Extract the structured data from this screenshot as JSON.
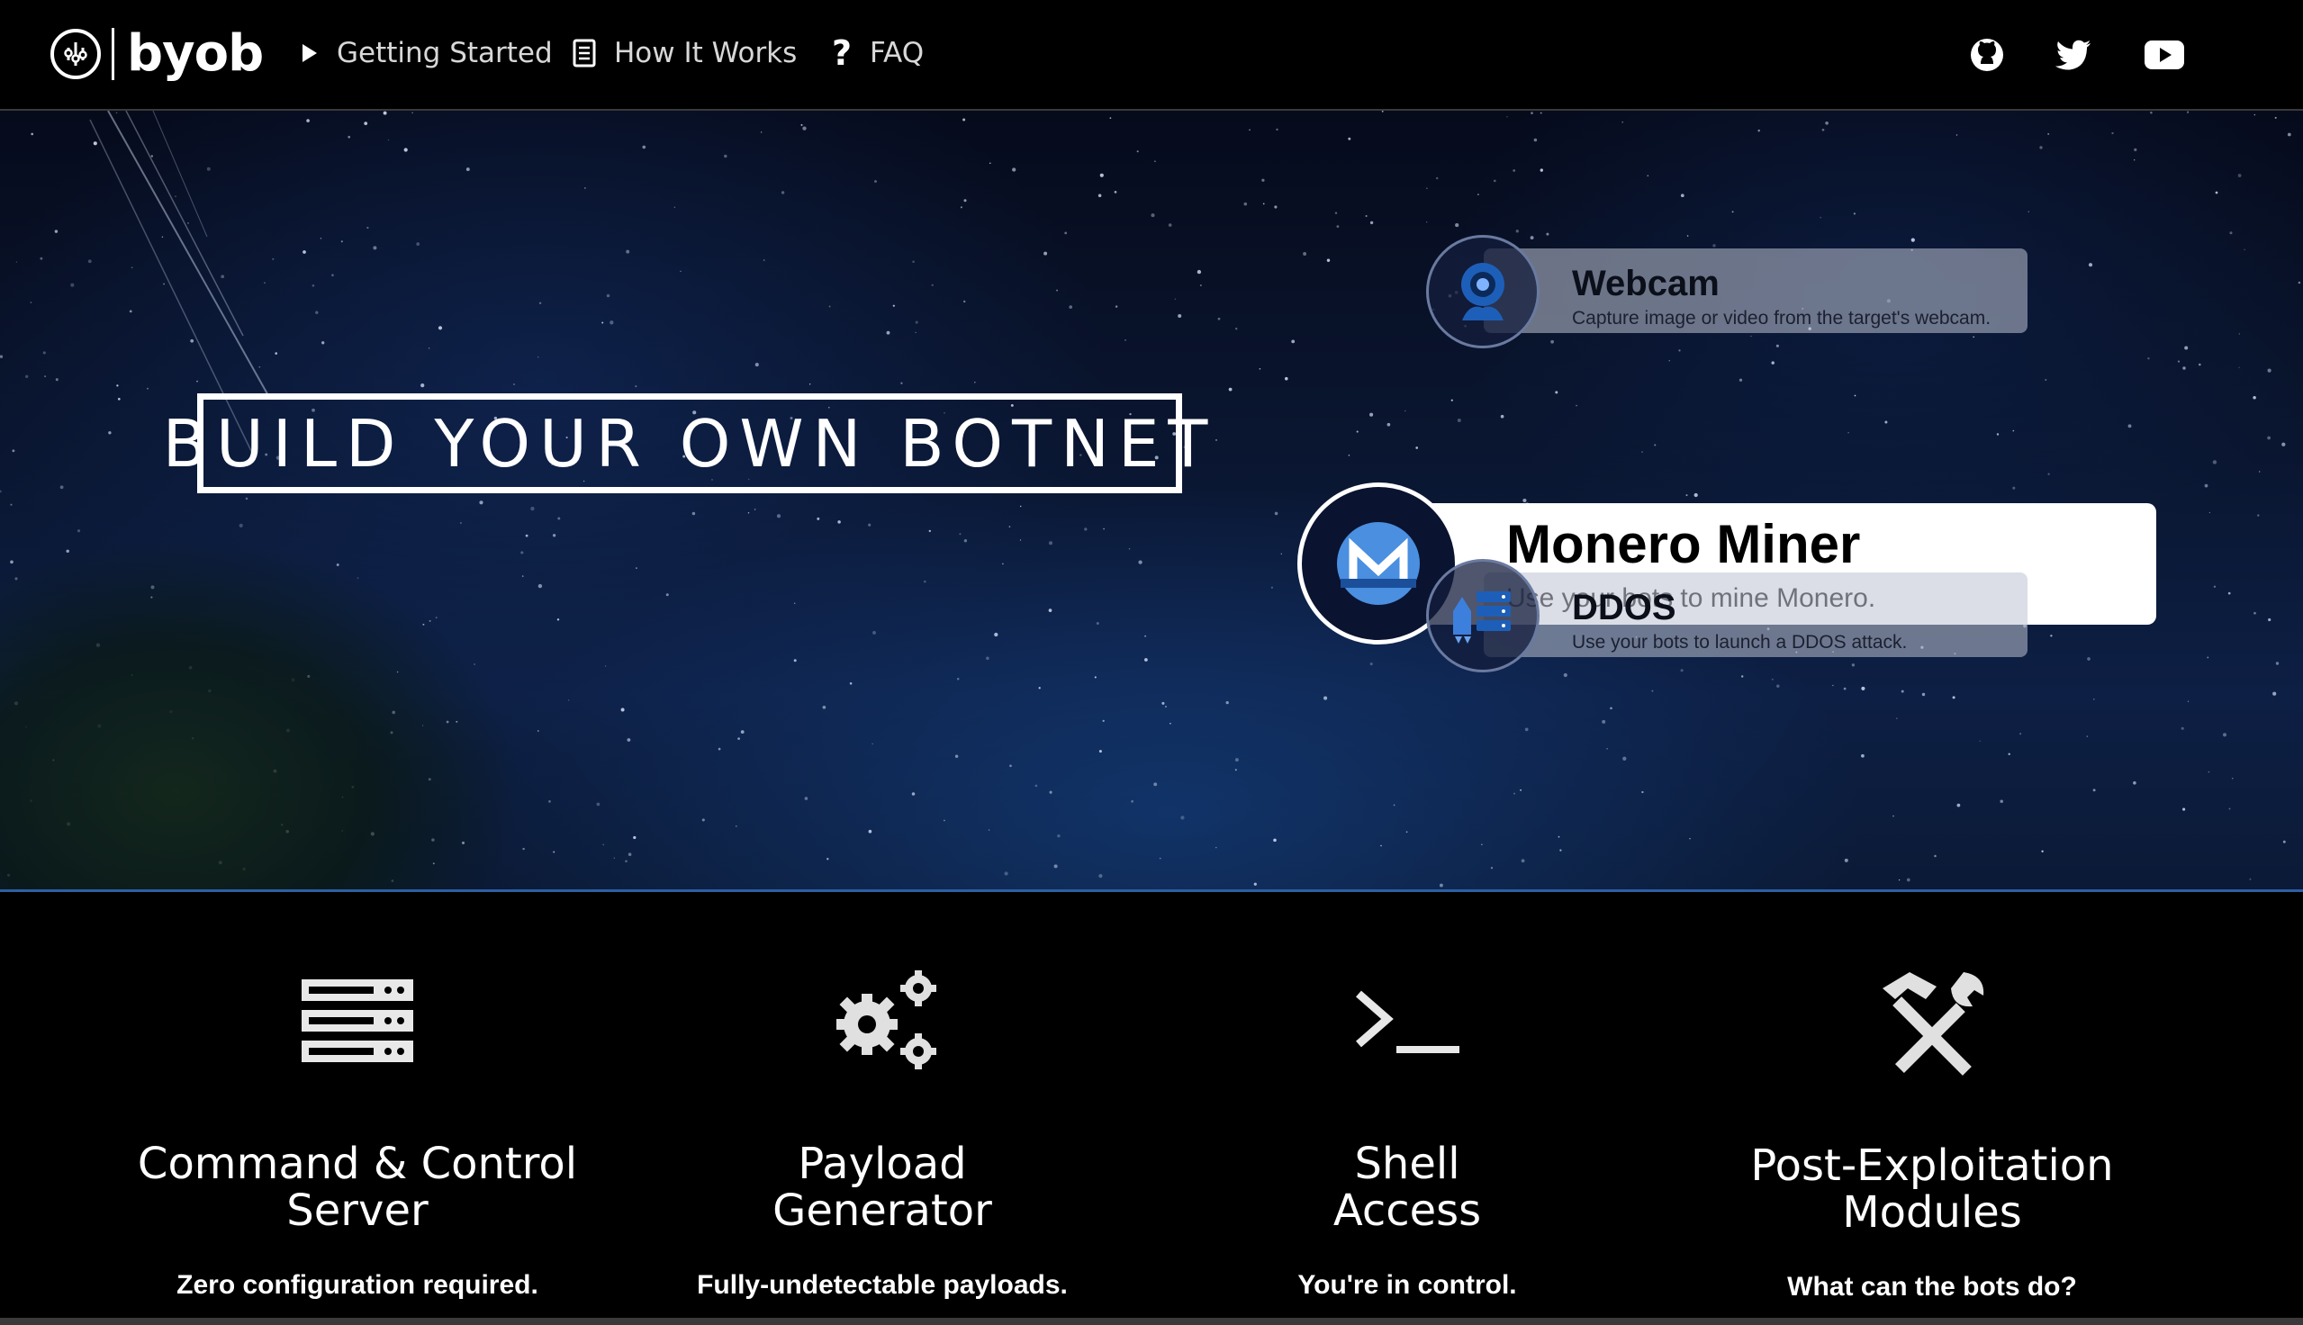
{
  "navbar": {
    "brand": "byob",
    "links": [
      {
        "label": "Getting Started",
        "icon": "play-icon"
      },
      {
        "label": "How It Works",
        "icon": "document-icon"
      },
      {
        "label": "FAQ",
        "icon": "question-icon"
      }
    ],
    "social": [
      "github-icon",
      "twitter-icon",
      "youtube-icon"
    ]
  },
  "hero": {
    "title": "BUILD YOUR OWN BOTNET",
    "features": [
      {
        "title": "Webcam",
        "subtitle": "Capture image or video from the target's webcam.",
        "icon": "webcam-icon"
      },
      {
        "title": "Monero Miner",
        "subtitle": "Use your bots to mine Monero.",
        "icon": "monero-icon"
      },
      {
        "title": "DDOS",
        "subtitle": "Use your bots to launch a DDOS attack.",
        "icon": "ddos-icon"
      }
    ]
  },
  "features": [
    {
      "title_line1": "Command & Control",
      "title_line2": "Server",
      "subtitle": "Zero configuration required.",
      "icon": "server-icon"
    },
    {
      "title_line1": "Payload",
      "title_line2": "Generator",
      "subtitle": "Fully-undetectable payloads.",
      "icon": "gears-icon"
    },
    {
      "title_line1": "Shell",
      "title_line2": "Access",
      "subtitle": "You're in control.",
      "icon": "terminal-icon"
    },
    {
      "title_line1": "Post-Exploitation",
      "title_line2": "Modules",
      "subtitle": "What can the bots do?",
      "icon": "tools-icon"
    }
  ],
  "colors": {
    "accent_blue": "#2d5fa3",
    "monero_blue": "#4a8fe0"
  }
}
